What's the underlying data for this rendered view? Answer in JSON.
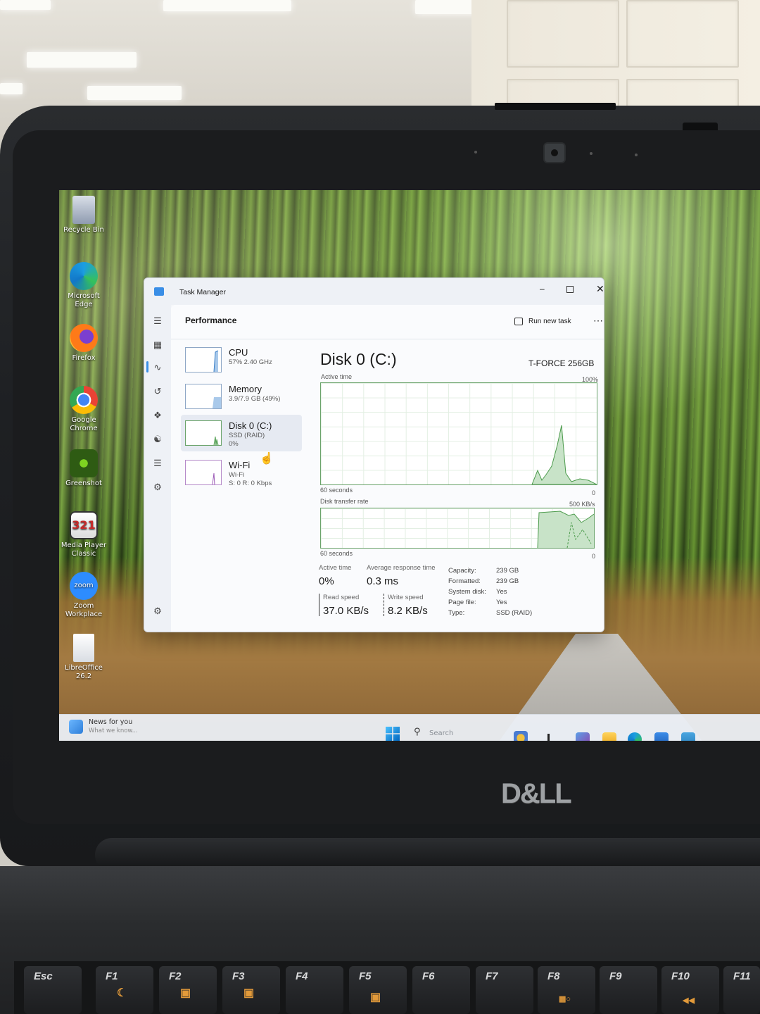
{
  "desktop": {
    "icons": [
      {
        "label": "Recycle Bin",
        "icon": "recycle-bin-icon"
      },
      {
        "label": "Microsoft Edge",
        "icon": "edge-icon"
      },
      {
        "label": "Firefox",
        "icon": "firefox-icon"
      },
      {
        "label": "Google Chrome",
        "icon": "chrome-icon"
      },
      {
        "label": "Greenshot",
        "icon": "greenshot-icon"
      },
      {
        "label": "Media Player Classic",
        "icon": "media-player-classic-icon"
      },
      {
        "label": "Zoom Workplace",
        "icon": "zoom-icon"
      },
      {
        "label": "LibreOffice 26.2",
        "icon": "libreoffice-icon"
      }
    ]
  },
  "taskbar": {
    "news_title": "News for you",
    "news_sub": "What we know...",
    "search_placeholder": "Search"
  },
  "task_manager": {
    "title": "Task Manager",
    "section": "Performance",
    "run_new_task": "Run new task",
    "more": "⋯",
    "items": [
      {
        "name": "CPU",
        "sub1": "57% 2.40 GHz",
        "sub2": ""
      },
      {
        "name": "Memory",
        "sub1": "3.9/7.9 GB (49%)",
        "sub2": ""
      },
      {
        "name": "Disk 0 (C:)",
        "sub1": "SSD (RAID)",
        "sub2": "0%"
      },
      {
        "name": "Wi-Fi",
        "sub1": "Wi-Fi",
        "sub2": "S: 0 R: 0 Kbps"
      }
    ],
    "detail": {
      "title": "Disk 0 (C:)",
      "model": "T-FORCE 256GB",
      "active_time_label": "Active time",
      "active_time_max": "100%",
      "sixty_seconds": "60 seconds",
      "zero": "0",
      "transfer_label": "Disk transfer rate",
      "transfer_max": "500 KB/s",
      "stats": {
        "active_time_h": "Active time",
        "active_time_v": "0%",
        "avg_resp_h": "Average response time",
        "avg_resp_v": "0.3 ms",
        "read_h": "Read speed",
        "read_v": "37.0 KB/s",
        "write_h": "Write speed",
        "write_v": "8.2 KB/s"
      },
      "props": [
        {
          "k": "Capacity:",
          "v": "239 GB"
        },
        {
          "k": "Formatted:",
          "v": "239 GB"
        },
        {
          "k": "System disk:",
          "v": "Yes"
        },
        {
          "k": "Page file:",
          "v": "Yes"
        },
        {
          "k": "Type:",
          "v": "SSD (RAID)"
        }
      ]
    }
  },
  "keyboard": {
    "keys": [
      "Esc",
      "F1",
      "F2",
      "F3",
      "F4",
      "F5",
      "F6",
      "F7",
      "F8",
      "F9",
      "F10",
      "F11"
    ]
  },
  "brand": "D&LL",
  "colors": {
    "accent": "#4a90d9",
    "graph_line": "#7fb97f",
    "graph_fill": "#c8e3c8"
  }
}
